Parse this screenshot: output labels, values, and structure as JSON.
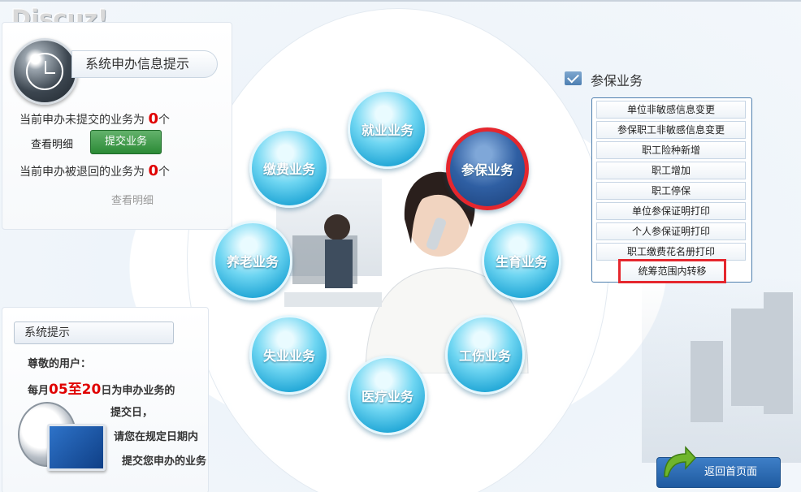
{
  "logo": "Discuz!",
  "left_panel": {
    "title": "系统申办信息提示",
    "unsubmitted_text": "当前申办未提交的业务为",
    "unsubmitted_count": "0",
    "unit": "个",
    "view_detail": "查看明细",
    "submit_button": "提交业务",
    "rejected_text": "当前申办被退回的业务为",
    "rejected_count": "0",
    "view_detail_gray": "查看明细"
  },
  "system_tip": {
    "title": "系统提示",
    "greeting": "尊敬的用户：",
    "line1_prefix": "每月",
    "line1_date": "05至20",
    "line1_suffix": "日为申办业务的",
    "line2": "提交日，",
    "line3": "请您在规定日期内",
    "line4": "提交您申办的业务"
  },
  "bubbles": {
    "jiuye": "就业业务",
    "canbao": "参保业务",
    "jiaofei": "缴费业务",
    "yanglao": "养老业务",
    "shengyu": "生育业务",
    "shiye": "失业业务",
    "gongshang": "工伤业务",
    "yiliao": "医疗业务"
  },
  "right_panel": {
    "title": "参保业务",
    "items": [
      "单位非敏感信息变更",
      "参保职工非敏感信息变更",
      "职工险种新增",
      "职工增加",
      "职工停保",
      "单位参保证明打印",
      "个人参保证明打印",
      "职工缴费花名册打印",
      "统筹范围内转移"
    ]
  },
  "return_button": "返回首页面",
  "colors": {
    "accent_red": "#e5272e",
    "bubble_blue": "#20a6d6",
    "selected_bubble": "#1b3f78",
    "green_button": "#2b8a35"
  }
}
